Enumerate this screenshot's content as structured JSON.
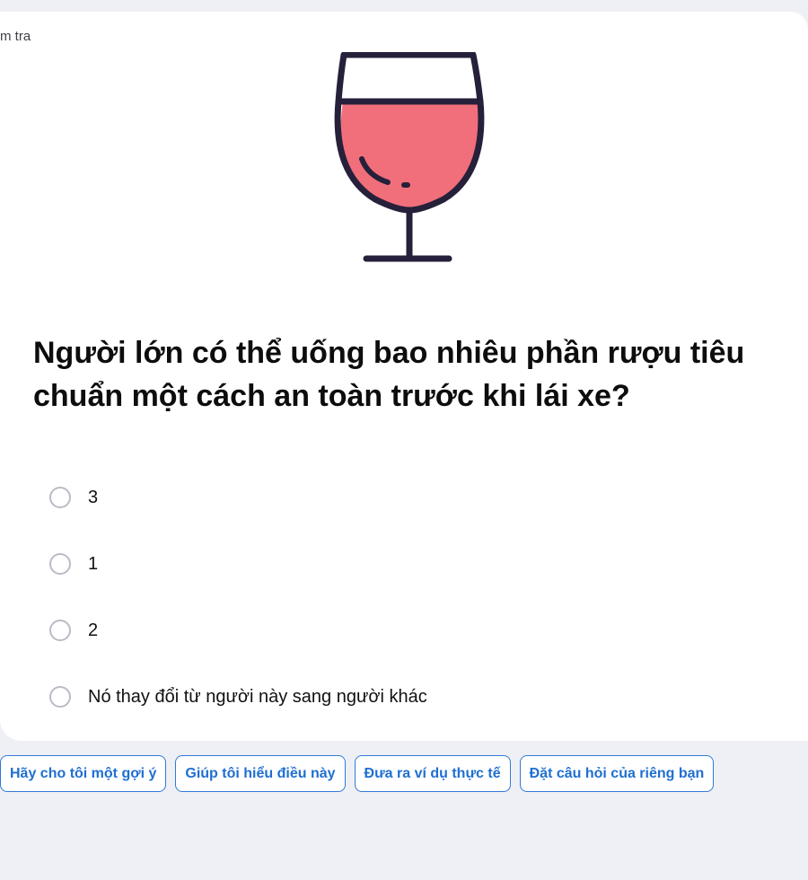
{
  "card": {
    "top_label": "m tra"
  },
  "illustration": {
    "icon": "wine-glass-icon",
    "colors": {
      "wine": "#f06f7b",
      "outline": "#27203a"
    }
  },
  "question": {
    "text": "Người lớn có thể uống bao nhiêu phần rượu tiêu chuẩn một cách an toàn trước khi lái xe?"
  },
  "options": [
    {
      "label": "3"
    },
    {
      "label": "1"
    },
    {
      "label": "2"
    },
    {
      "label": "Nó thay đổi từ người này sang người khác"
    }
  ],
  "suggestions": [
    {
      "label": "Hãy cho tôi một gợi ý"
    },
    {
      "label": "Giúp tôi hiểu điều này"
    },
    {
      "label": "Đưa ra ví dụ thực tế"
    },
    {
      "label": "Đặt câu hỏi của riêng bạn"
    }
  ],
  "colors": {
    "background": "#eff0f5",
    "card": "#ffffff",
    "accent": "#1f6fd1",
    "radio_border": "#b9bcc6"
  }
}
